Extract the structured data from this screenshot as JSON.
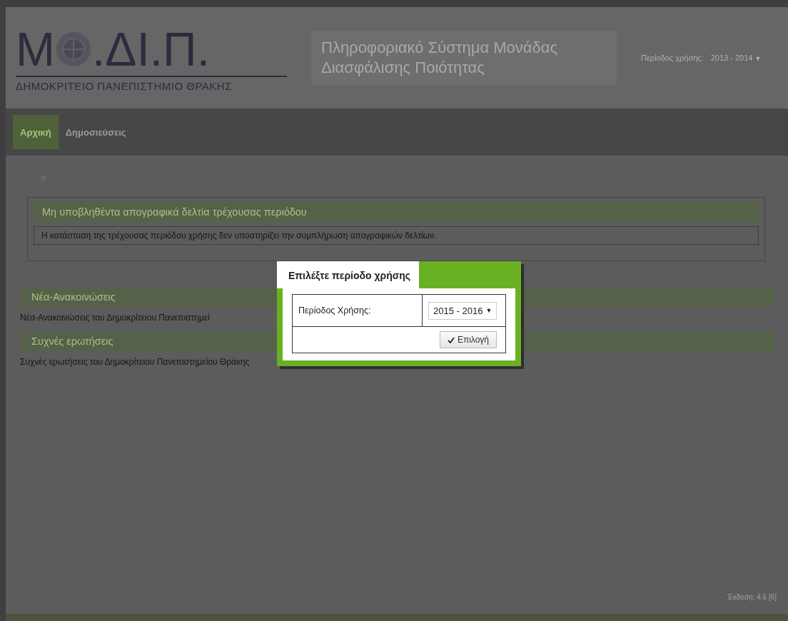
{
  "logo": {
    "first_letter": "Μ",
    "rest": ".ΔΙ.Π.",
    "subtitle": "ΔΗΜΟΚΡΙΤΕΙΟ ΠΑΝΕΠΙΣΤΗΜΙΟ ΘΡΑΚΗΣ"
  },
  "system_title": [
    "Πληροφοριακό Σύστημα Μονάδας",
    "Διασφάλισης Ποιότητας"
  ],
  "period": {
    "label": "Περίοδος χρήσης:",
    "value": "2013 - 2014",
    "caret": "▼"
  },
  "nav": [
    {
      "label": "Αρχική",
      "selected": true
    },
    {
      "label": "Δημοσιεύσεις",
      "selected": false
    }
  ],
  "panel": {
    "title": "Μη υποβληθέντα απογραφικά δελτία τρέχουσας περιόδου",
    "message": "Η κατάσταση της τρέχουσας περιόδου χρήσης δεν υποστηρίζει την συμπλήρωση απογραφικών δελτίων."
  },
  "sections": [
    {
      "title": "Νέα-Ανακοινώσεις",
      "text": "Νέα-Ανακοινώσεις του Δημοκρίτειου Πανεπιστημεί"
    },
    {
      "title": "Συχνές ερωτήσεις",
      "text": "Συχνές ερωτήσεις του Δημοκρίτειου Πανεπιστημείου Θράκης"
    }
  ],
  "version": "Έκδοση: 4.6 [6]",
  "dialog": {
    "title": "Επιλέξτε περίοδο χρήσης",
    "field_label": "Περίοδος Χρήσης:",
    "value": "2015 - 2016",
    "caret": "▼",
    "button": "Επιλογή"
  }
}
